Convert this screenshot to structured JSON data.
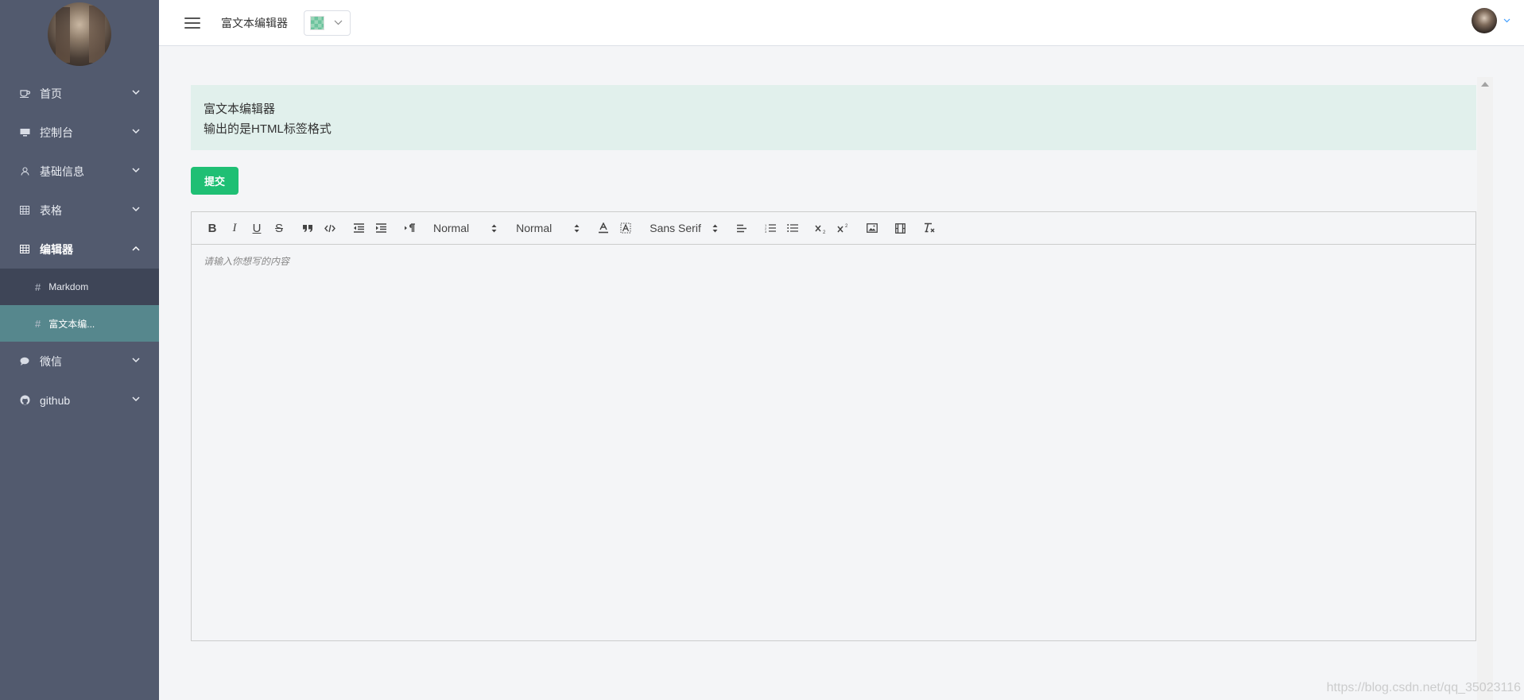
{
  "header": {
    "page_title": "富文本编辑器"
  },
  "sidebar": {
    "items": [
      {
        "label": "首页",
        "icon": "coffee-icon"
      },
      {
        "label": "控制台",
        "icon": "monitor-icon"
      },
      {
        "label": "基础信息",
        "icon": "user-icon"
      },
      {
        "label": "表格",
        "icon": "table-icon"
      },
      {
        "label": "编辑器",
        "icon": "table-icon",
        "expanded": true,
        "children": [
          {
            "label": "Markdom"
          },
          {
            "label": "富文本编...",
            "active": true
          }
        ]
      },
      {
        "label": "微信",
        "icon": "chat-icon"
      },
      {
        "label": "github",
        "icon": "github-icon"
      }
    ]
  },
  "notice": {
    "line1": "富文本编辑器",
    "line2": "输出的是HTML标签格式"
  },
  "submit_label": "提交",
  "toolbar": {
    "header_select": "Normal",
    "size_select": "Normal",
    "font_select": "Sans Serif"
  },
  "editor": {
    "placeholder": "请输入你想写的内容"
  },
  "watermark": "https://blog.csdn.net/qq_35023116",
  "colors": {
    "sidebar_bg": "#525a6e",
    "submenu_bg": "#3e4557",
    "active_submenu": "#56878d",
    "notice_bg": "#e1f0ec",
    "primary_button": "#1fbf74"
  }
}
